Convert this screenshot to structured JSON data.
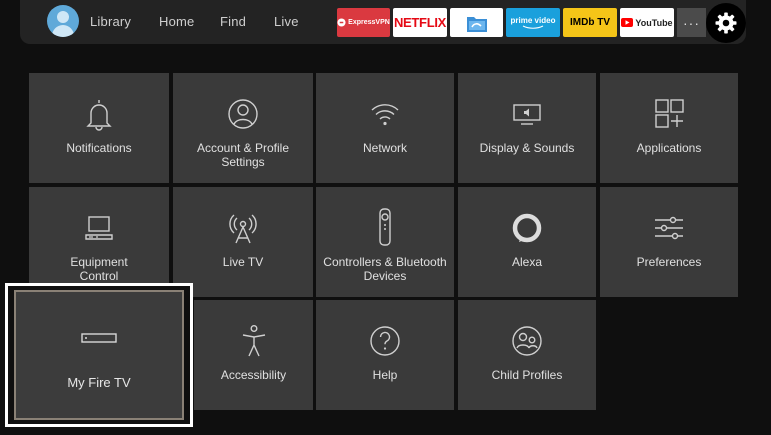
{
  "nav": {
    "items": [
      "Library",
      "Home",
      "Find",
      "Live"
    ]
  },
  "apps": [
    {
      "name": "ExpressVPN",
      "label": "ExpressVPN",
      "bg": "#da3940",
      "fg": "#ffffff",
      "icon": "expressvpn-icon"
    },
    {
      "name": "Netflix",
      "label": "NETFLIX",
      "bg": "#ffffff",
      "fg": "#e50914",
      "icon": "netflix-logo"
    },
    {
      "name": "File Manager",
      "label": "",
      "bg": "#ffffff",
      "fg": "#3b8fd6",
      "icon": "file-manager-icon"
    },
    {
      "name": "Prime Video",
      "label": "prime video",
      "bg": "#1aa0dc",
      "fg": "#ffffff",
      "icon": "prime-video-logo"
    },
    {
      "name": "IMDb TV",
      "label": "IMDb TV",
      "bg": "#f5c518",
      "fg": "#000000",
      "icon": "imdb-tv-logo"
    },
    {
      "name": "YouTube",
      "label": "YouTube",
      "bg": "#ffffff",
      "fg": "#222222",
      "icon": "youtube-logo"
    }
  ],
  "more_label": "···",
  "settings": [
    {
      "key": "notifications",
      "label": "Notifications",
      "icon": "bell-icon"
    },
    {
      "key": "account",
      "label": "Account & Profile Settings",
      "icon": "profile-icon"
    },
    {
      "key": "network",
      "label": "Network",
      "icon": "wifi-icon"
    },
    {
      "key": "display",
      "label": "Display & Sounds",
      "icon": "display-sound-icon"
    },
    {
      "key": "applications",
      "label": "Applications",
      "icon": "apps-grid-icon"
    },
    {
      "key": "equipment",
      "label": "Equipment Control",
      "icon": "tv-remote-equipment-icon"
    },
    {
      "key": "livetv",
      "label": "Live TV",
      "icon": "antenna-icon"
    },
    {
      "key": "controllers",
      "label": "Controllers & Bluetooth Devices",
      "icon": "remote-control-icon"
    },
    {
      "key": "alexa",
      "label": "Alexa",
      "icon": "alexa-icon"
    },
    {
      "key": "preferences",
      "label": "Preferences",
      "icon": "sliders-icon"
    },
    {
      "key": "myfiretv",
      "label": "My Fire TV",
      "icon": "fire-tv-device-icon"
    },
    {
      "key": "accessibility",
      "label": "Accessibility",
      "icon": "accessibility-icon"
    },
    {
      "key": "help",
      "label": "Help",
      "icon": "help-icon"
    },
    {
      "key": "childprofiles",
      "label": "Child Profiles",
      "icon": "child-profiles-icon"
    }
  ],
  "focused": "My Fire TV"
}
